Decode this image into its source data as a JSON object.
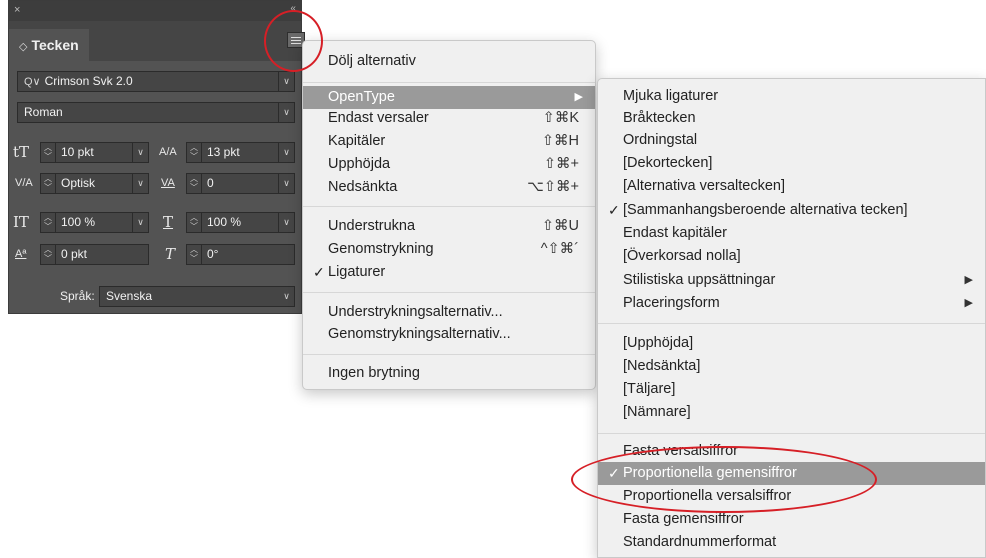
{
  "panel": {
    "close_glyph": "×",
    "collapse_glyph": "‹‹",
    "tab_arrows": "◇",
    "tab_label": "Tecken",
    "font_family": "Crimson Svk 2.0",
    "search_glyph": "Q∨",
    "font_style": "Roman",
    "font_size": "10 pkt",
    "leading": "13 pkt",
    "kerning": "Optisk",
    "tracking": "0",
    "vertical_scale": "100 %",
    "horizontal_scale": "100 %",
    "baseline_shift": "0 pkt",
    "skew": "0°",
    "language_label": "Språk:",
    "language_value": "Svenska",
    "icons": {
      "font_size": "tT",
      "leading": "A/A",
      "kerning": "V/A",
      "tracking": "VA",
      "vscale": "IT",
      "hscale": "T",
      "baseline": "Aª",
      "skew": "T"
    }
  },
  "main_menu": {
    "items": [
      {
        "label": "Dölj alternativ"
      },
      {
        "label": "OpenType",
        "submenu": "▶"
      },
      {
        "label": "Endast versaler",
        "shortcut": "⇧⌘K"
      },
      {
        "label": "Kapitäler",
        "shortcut": "⇧⌘H"
      },
      {
        "label": "Upphöjda",
        "shortcut": "⇧⌘+"
      },
      {
        "label": "Nedsänkta",
        "shortcut": "⌥⇧⌘+"
      },
      {
        "label": "Understrukna",
        "shortcut": "⇧⌘U"
      },
      {
        "label": "Genomstrykning",
        "shortcut": "^⇧⌘´"
      },
      {
        "label": "Ligaturer",
        "check": "✓"
      },
      {
        "label": "Understrykningsalternativ..."
      },
      {
        "label": "Genomstrykningsalternativ..."
      },
      {
        "label": "Ingen brytning"
      }
    ]
  },
  "opentype_menu": {
    "items": [
      {
        "label": "Mjuka ligaturer"
      },
      {
        "label": "Bråktecken"
      },
      {
        "label": "Ordningstal"
      },
      {
        "label": "[Dekortecken]"
      },
      {
        "label": "[Alternativa versaltecken]"
      },
      {
        "label": "[Sammanhangsberoende alternativa tecken]",
        "check": "✓"
      },
      {
        "label": "Endast kapitäler"
      },
      {
        "label": "[Överkorsad nolla]"
      },
      {
        "label": "Stilistiska uppsättningar",
        "submenu": "▶"
      },
      {
        "label": "Placeringsform",
        "submenu": "▶"
      },
      {
        "label": "[Upphöjda]"
      },
      {
        "label": "[Nedsänkta]"
      },
      {
        "label": "[Täljare]"
      },
      {
        "label": "[Nämnare]"
      },
      {
        "label": "Fasta versalsiffror"
      },
      {
        "label": "Proportionella gemensiffror",
        "check": "✓"
      },
      {
        "label": "Proportionella versalsiffror"
      },
      {
        "label": "Fasta gemensiffror"
      },
      {
        "label": "Standardnummerformat"
      }
    ]
  },
  "colors": {
    "panel_bg": "#535353",
    "menu_bg": "#f0f0f0",
    "highlight": "#9a9a9a",
    "annotation": "#d61f26"
  }
}
